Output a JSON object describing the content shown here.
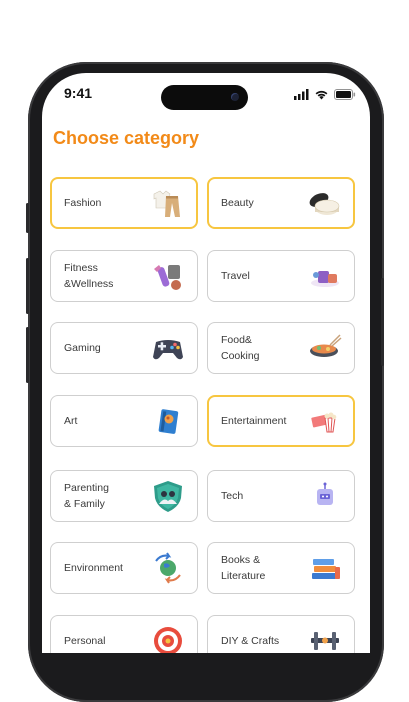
{
  "status": {
    "time": "9:41"
  },
  "header": {
    "title": "Choose category"
  },
  "colors": {
    "accent": "#f28a18",
    "selected_border": "#f7c640"
  },
  "categories": [
    {
      "label": "Fashion",
      "icon": "clothes-icon",
      "selected": true
    },
    {
      "label": "Beauty",
      "icon": "cosmetics-jar-icon",
      "selected": true
    },
    {
      "label": "Fitness\n&Wellness",
      "icon": "fitness-equipment-icon",
      "selected": false
    },
    {
      "label": "Travel",
      "icon": "travel-luggage-icon",
      "selected": false
    },
    {
      "label": "Gaming",
      "icon": "gamepad-icon",
      "selected": false
    },
    {
      "label": "Food&\nCooking",
      "icon": "food-bowl-icon",
      "selected": false
    },
    {
      "label": "Art",
      "icon": "art-book-icon",
      "selected": false
    },
    {
      "label": "Entertainment",
      "icon": "popcorn-ticket-icon",
      "selected": true
    },
    {
      "label": "Parenting\n& Family",
      "icon": "family-shield-icon",
      "selected": false
    },
    {
      "label": "Tech",
      "icon": "robot-icon",
      "selected": false
    },
    {
      "label": "Environment",
      "icon": "earth-recycle-icon",
      "selected": false
    },
    {
      "label": "Books &\nLiterature",
      "icon": "books-stack-icon",
      "selected": false
    },
    {
      "label": "Personal",
      "icon": "target-icon",
      "selected": false
    },
    {
      "label": "DIY & Crafts",
      "icon": "tools-icon",
      "selected": false
    }
  ]
}
